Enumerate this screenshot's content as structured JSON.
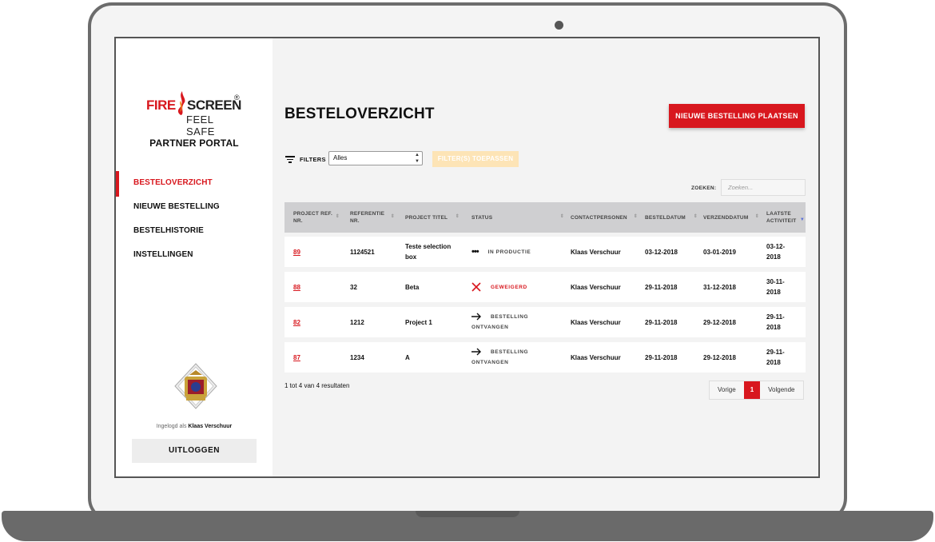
{
  "brand": {
    "logo_fire": "FIRE",
    "logo_screen": "SCREEN",
    "logo_tagline": "FEEL SAFE",
    "portal_label": "PARTNER PORTAL",
    "accent": "#d8171e"
  },
  "sidebar": {
    "items": [
      {
        "label": "BESTELOVERZICHT",
        "active": true
      },
      {
        "label": "NIEUWE BESTELLING",
        "active": false
      },
      {
        "label": "BESTELHISTORIE",
        "active": false
      },
      {
        "label": "INSTELLINGEN",
        "active": false
      }
    ],
    "logged_in_prefix": "Ingelogd als",
    "logged_in_user": "Klaas Verschuur",
    "logout_label": "UITLOGGEN"
  },
  "main": {
    "title": "BESTELOVERZICHT",
    "new_order_label": "NIEUWE BESTELLING PLAATSEN",
    "filters_label": "FILTERS",
    "filter_select_value": "Alles",
    "apply_filters_label": "FILTER(S) TOEPASSEN",
    "search_label": "ZOEKEN:",
    "search_placeholder": "Zoeken..."
  },
  "table": {
    "headers": [
      "PROJECT REF. NR.",
      "REFERENTIE NR.",
      "PROJECT TITEL",
      "STATUS",
      "CONTACTPERSONEN",
      "BESTELDATUM",
      "VERZENDDATUM",
      "LAATSTE ACTIVITEIT"
    ],
    "rows": [
      {
        "ref": "89",
        "referentie": "1124521",
        "titel": "Teste selection box",
        "status_icon": "dots-icon",
        "status": "IN PRODUCTIE",
        "contact": "Klaas Verschuur",
        "besteldatum": "03-12-2018",
        "verzenddatum": "03-01-2019",
        "activiteit": "03-12-2018"
      },
      {
        "ref": "88",
        "referentie": "32",
        "titel": "Beta",
        "status_icon": "x-icon",
        "status": "GEWEIGERD",
        "contact": "Klaas Verschuur",
        "besteldatum": "29-11-2018",
        "verzenddatum": "31-12-2018",
        "activiteit": "30-11-2018"
      },
      {
        "ref": "82",
        "referentie": "1212",
        "titel": "Project 1",
        "status_icon": "arrow-right-icon",
        "status": "BESTELLING ONTVANGEN",
        "contact": "Klaas Verschuur",
        "besteldatum": "29-11-2018",
        "verzenddatum": "29-12-2018",
        "activiteit": "29-11-2018"
      },
      {
        "ref": "87",
        "referentie": "1234",
        "titel": "A",
        "status_icon": "arrow-right-icon",
        "status": "BESTELLING ONTVANGEN",
        "contact": "Klaas Verschuur",
        "besteldatum": "29-11-2018",
        "verzenddatum": "29-12-2018",
        "activiteit": "29-11-2018"
      }
    ]
  },
  "footer": {
    "result_count": "1 tot 4 van 4 resultaten",
    "prev_label": "Vorige",
    "current_page": "1",
    "next_label": "Volgende"
  }
}
